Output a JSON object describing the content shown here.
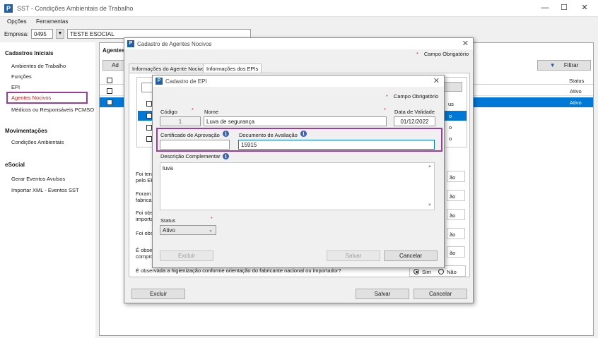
{
  "app": {
    "title": "SST - Condições Ambientais de Trabalho",
    "menu": [
      "Opções",
      "Ferramentas"
    ],
    "empresa_label": "Empresa:",
    "empresa_code": "0495",
    "empresa_name": "TESTE ESOCIAL"
  },
  "sidebar": {
    "sections": [
      {
        "title": "Cadastros Iniciais",
        "items": [
          "Ambientes de Trabalho",
          "Funções",
          "EPI",
          "Agentes Nocivos",
          "Médicos ou Responsáveis PCMSO"
        ]
      },
      {
        "title": "Movimentações",
        "items": [
          "Condições Ambientais"
        ]
      },
      {
        "title": "eSocial",
        "items": [
          "Gerar Eventos Avulsos",
          "Importar XML - Eventos SST"
        ]
      }
    ],
    "active_item": "Agentes Nocivos"
  },
  "main": {
    "agents_label": "Agentes",
    "add_label": "Ad",
    "filter_label": "Filtrar",
    "status_header": "Status",
    "rows": [
      "Ativo",
      "Ativo"
    ]
  },
  "agent_dialog": {
    "title": "Cadastro de Agentes Nocivos",
    "required_note": "Campo Obrigatório",
    "tabs": [
      "Informações do Agente Nocivo",
      "Informações dos EPIs"
    ],
    "col_partial": "us",
    "status_partial": [
      "o",
      "o",
      "o"
    ],
    "questions": [
      "Foi tent",
      "pelo EP",
      "Foram c",
      "fabricar",
      "Foi obse",
      "importa",
      "Foi obse",
      "É obser",
      "compro"
    ],
    "answers_partial": [
      "ão",
      "ão",
      "ão",
      "ão",
      "ão"
    ],
    "last_question": "É observada a higienização conforme orientação do fabricante nacional ou importador?",
    "yes": "Sim",
    "no": "Não",
    "delete": "Excluir",
    "save": "Salvar",
    "cancel": "Cancelar"
  },
  "epi_dialog": {
    "title": "Cadastro de EPI",
    "required_note": "Campo Obrigatório",
    "code_label": "Código",
    "code_value": "1",
    "name_label": "Nome",
    "name_value": "Luva de segurança",
    "date_label": "Data de Validade",
    "date_value": "01/12/2022",
    "ca_label": "Certificado de Aprovação",
    "ca_value": "",
    "doc_label": "Documento de Avaliação",
    "doc_value": "15915",
    "desc_label": "Descrição Complementar",
    "desc_value": "luva",
    "status_label": "Status",
    "status_value": "Ativo",
    "delete": "Excluir",
    "save": "Salvar",
    "cancel": "Cancelar",
    "info_glyph": "i"
  },
  "colors": {
    "highlight": "#9b3c9b",
    "selected_row": "#0078d7",
    "active_link": "#d02020"
  }
}
